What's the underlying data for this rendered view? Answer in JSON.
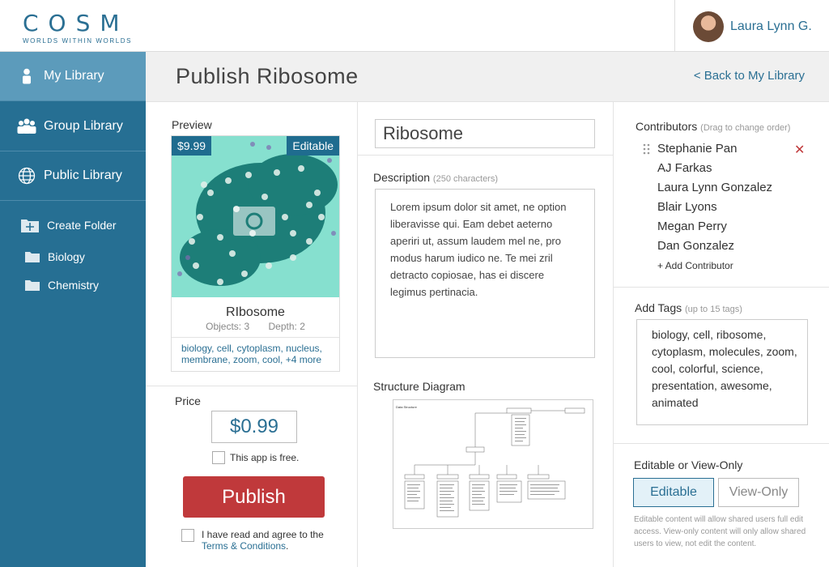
{
  "header": {
    "logo_word": "COSM",
    "logo_tagline": "WORLDS WITHIN WORLDS",
    "user_name": "Laura Lynn G."
  },
  "sidebar": {
    "items": [
      {
        "label": "My Library",
        "icon": "person-icon",
        "active": true
      },
      {
        "label": "Group Library",
        "icon": "group-icon",
        "active": false
      },
      {
        "label": "Public Library",
        "icon": "globe-icon",
        "active": false
      }
    ],
    "create_folder": "Create Folder",
    "folders": [
      "Biology",
      "Chemistry"
    ]
  },
  "title": {
    "page_title": "Publish Ribosome",
    "back_link": "< Back to My Library"
  },
  "preview": {
    "label": "Preview",
    "price_tag": "$9.99",
    "edit_tag": "Editable",
    "name": "RIbosome",
    "objects": "Objects: 3",
    "depth": "Depth: 2",
    "tags_line1": "biology, cell, cytoplasm, nucleus,",
    "tags_line2": "membrane, zoom, cool,",
    "tags_more": "+4 more"
  },
  "pricing": {
    "label": "Price",
    "value": "$0.99",
    "free_label": "This app is free.",
    "free_checked": false,
    "publish_label": "Publish",
    "agree_text": "I have read and agree to the",
    "terms_link": "Terms & Conditions",
    "terms_end": ".",
    "agree_checked": false
  },
  "details": {
    "name_value": "Ribosome",
    "description_label": "Description",
    "description_hint": "(250 characters)",
    "description_text": "Lorem ipsum dolor sit amet, ne option liberavisse qui. Eam debet aeterno aperiri ut, assum laudem mel ne, pro modus harum iudico ne. Te mei zril detracto copiosae, has ei discere legimus pertinacia.",
    "structure_label": "Structure Diagram",
    "diagram_caption": "Data Structure"
  },
  "contributors": {
    "label": "Contributors",
    "hint": "(Drag to change order)",
    "names": [
      "Stephanie Pan",
      "AJ Farkas",
      "Laura Lynn Gonzalez",
      "Blair Lyons",
      "Megan Perry",
      "Dan Gonzalez"
    ],
    "remove_symbol": "✕",
    "add_label": "+ Add Contributor"
  },
  "tags": {
    "label": "Add Tags",
    "hint": "(up to 15 tags)",
    "value": "biology, cell, ribosome, cytoplasm, molecules, zoom, cool, colorful, science, presentation, awesome, animated"
  },
  "access": {
    "label": "Editable or View-Only",
    "editable_label": "Editable",
    "viewonly_label": "View-Only",
    "selected": "Editable",
    "note": "Editable content will allow shared users full edit access. View-only content will only allow shared users to view, not edit the content."
  },
  "colors": {
    "brand": "#2a6f93",
    "sidebar": "#266f93",
    "publish": "#c0393b",
    "remove": "#c0393b"
  }
}
